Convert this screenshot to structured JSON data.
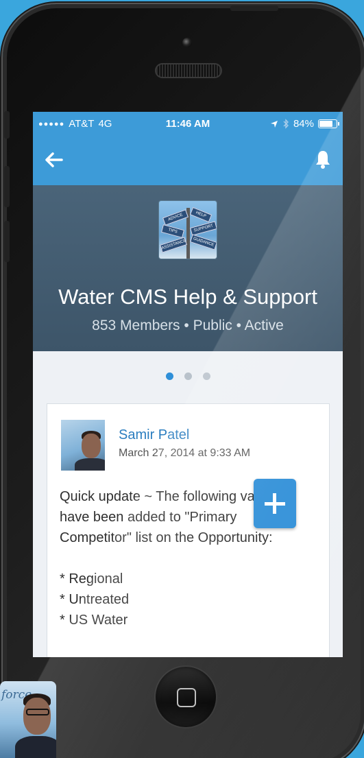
{
  "colors": {
    "background": "#3aa6dd",
    "accent": "#3d9bd8",
    "header": "#4a6479",
    "link": "#2a7dbf",
    "fab": "#2f8fd8"
  },
  "status_bar": {
    "signal_dots": "●●●●●",
    "carrier": "AT&T",
    "network": "4G",
    "time": "11:46 AM",
    "battery": "84%",
    "battery_level": 0.84,
    "icons": [
      "location-arrow-icon",
      "bluetooth-icon",
      "battery-icon"
    ]
  },
  "nav_bar": {
    "back_icon": "back-arrow-icon",
    "notifications_icon": "bell-icon"
  },
  "group": {
    "title": "Water CMS Help & Support",
    "meta": "853 Members • Public • Active",
    "photo_signs": [
      "ADVICE",
      "HELP",
      "TIPS",
      "SUPPORT",
      "ASSISTANCE",
      "GUIDANCE"
    ]
  },
  "pager": {
    "total": 3,
    "active_index": 0
  },
  "post": {
    "author": "Samir Patel",
    "date": "March 27, 2014 at 9:33 AM",
    "body_lines": [
      "Quick update ~ The following values",
      "have been added to \"Primary",
      "Competitor\" list on the Opportunity:"
    ],
    "bullets": [
      "* Regional",
      "* Untreated",
      "* US Water"
    ]
  },
  "fab": {
    "icon": "plus-icon"
  },
  "presenter": {
    "logo_text": "force"
  }
}
